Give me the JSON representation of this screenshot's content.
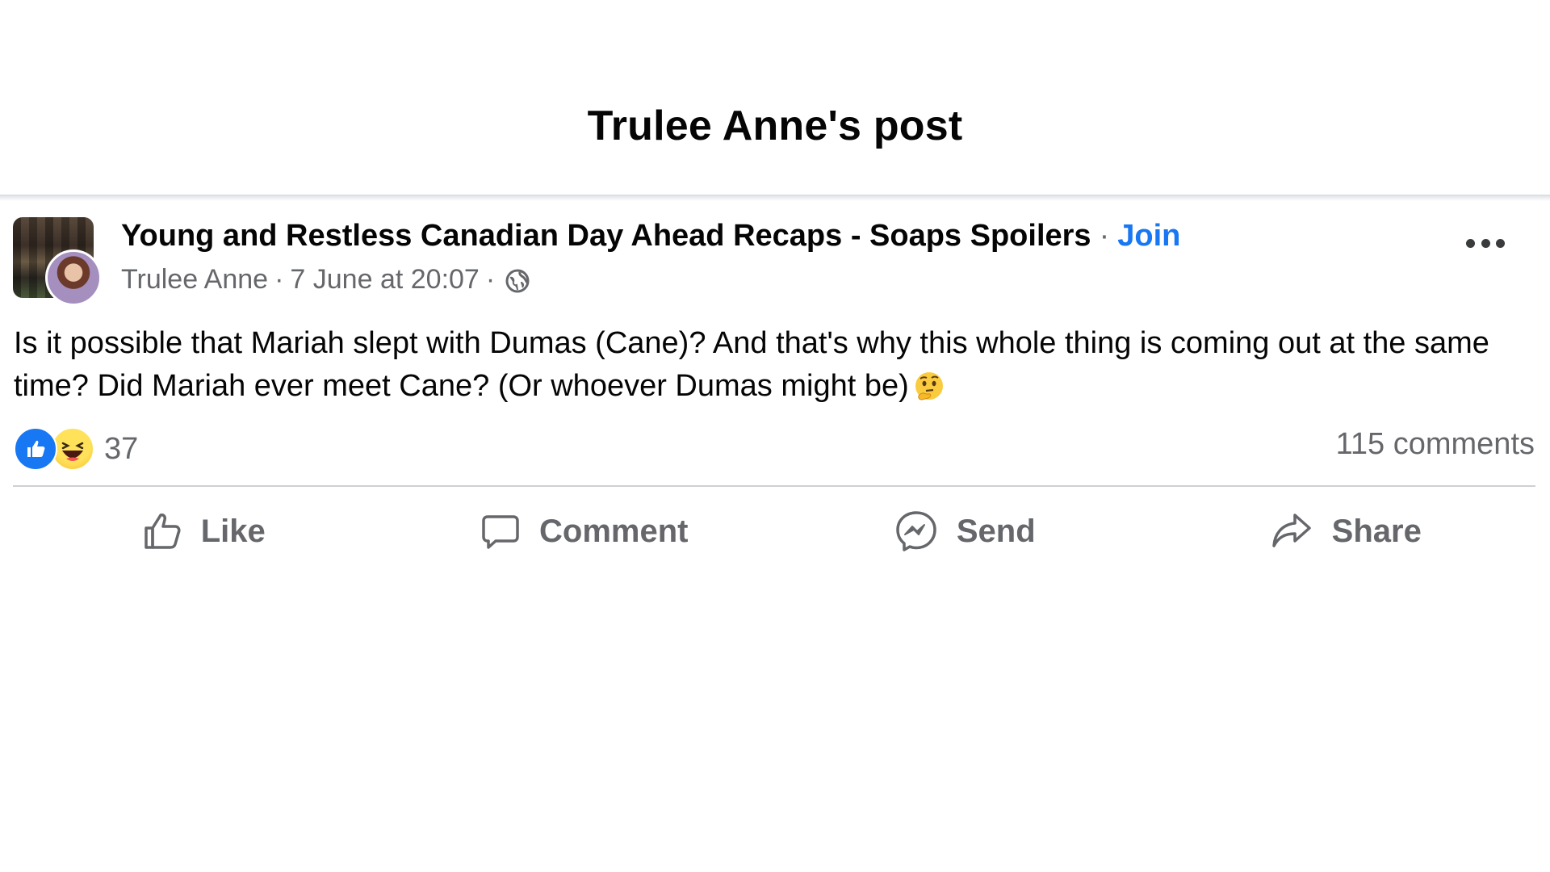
{
  "modal": {
    "title": "Trulee Anne's post"
  },
  "post": {
    "group_name": "Young and Restless Canadian Day Ahead Recaps - Soaps Spoilers",
    "group_sep": "·",
    "join_label": "Join",
    "author": "Trulee Anne",
    "meta_sep": "·",
    "timestamp": "7 June at 20:07",
    "privacy_icon": "globe-icon",
    "text": "Is it possible that Mariah slept with Dumas (Cane)? And that's why this whole thing is coming out at the same time? Did Mariah ever meet Cane? (Or whoever Dumas might be)",
    "text_emoji": "thinking-face-icon"
  },
  "stats": {
    "reactions": [
      "like",
      "haha"
    ],
    "reaction_count": "37",
    "comments": "115 comments"
  },
  "actions": {
    "like": "Like",
    "comment": "Comment",
    "send": "Send",
    "share": "Share"
  },
  "colors": {
    "accent": "#1877f2",
    "secondary_text": "#65676b",
    "primary_text": "#050505",
    "divider": "#ced0d4"
  }
}
